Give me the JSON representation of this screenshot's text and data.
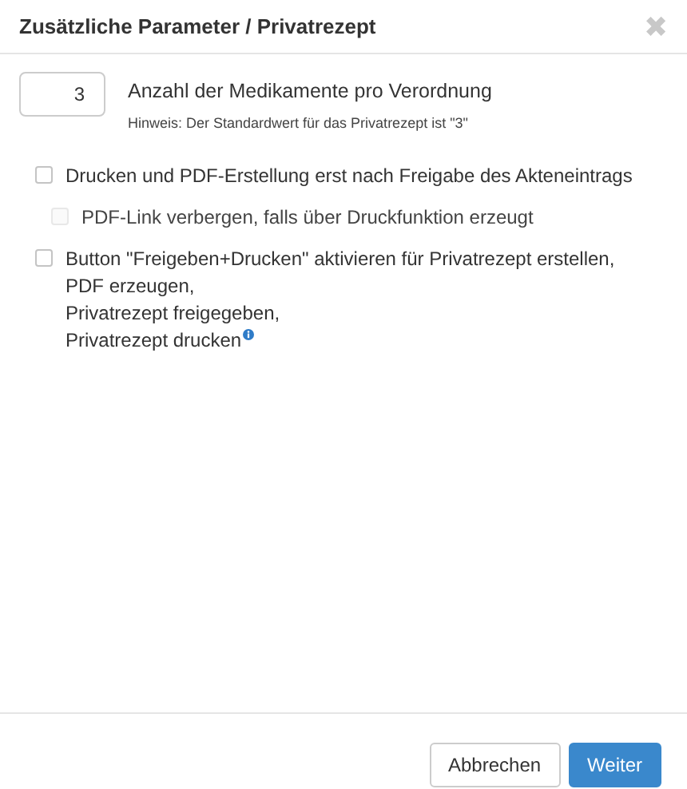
{
  "dialog": {
    "title": "Zusätzliche Parameter / Privatrezept",
    "close": "✖"
  },
  "count_field": {
    "value": "3",
    "label": "Anzahl der Medikamente pro Verordnung",
    "hint": "Hinweis: Der Standardwert für das Privatrezept ist \"3\""
  },
  "options": [
    {
      "lines": [
        "Drucken und PDF-Erstellung erst nach Freigabe des Akteneintrags"
      ],
      "checked": false,
      "disabled": false,
      "children": [
        {
          "lines": [
            "PDF-Link verbergen, falls über Druckfunktion erzeugt"
          ],
          "checked": false,
          "disabled": true
        }
      ]
    },
    {
      "lines": [
        "Button \"Freigeben+Drucken\" aktivieren für Privatrezept erstellen,",
        "PDF erzeugen,",
        "Privatrezept freigegeben,",
        "Privatrezept drucken"
      ],
      "checked": false,
      "disabled": false,
      "info": true
    }
  ],
  "buttons": [
    {
      "label": "Abbrechen",
      "kind": "secondary"
    },
    {
      "label": "Weiter",
      "kind": "primary"
    }
  ]
}
